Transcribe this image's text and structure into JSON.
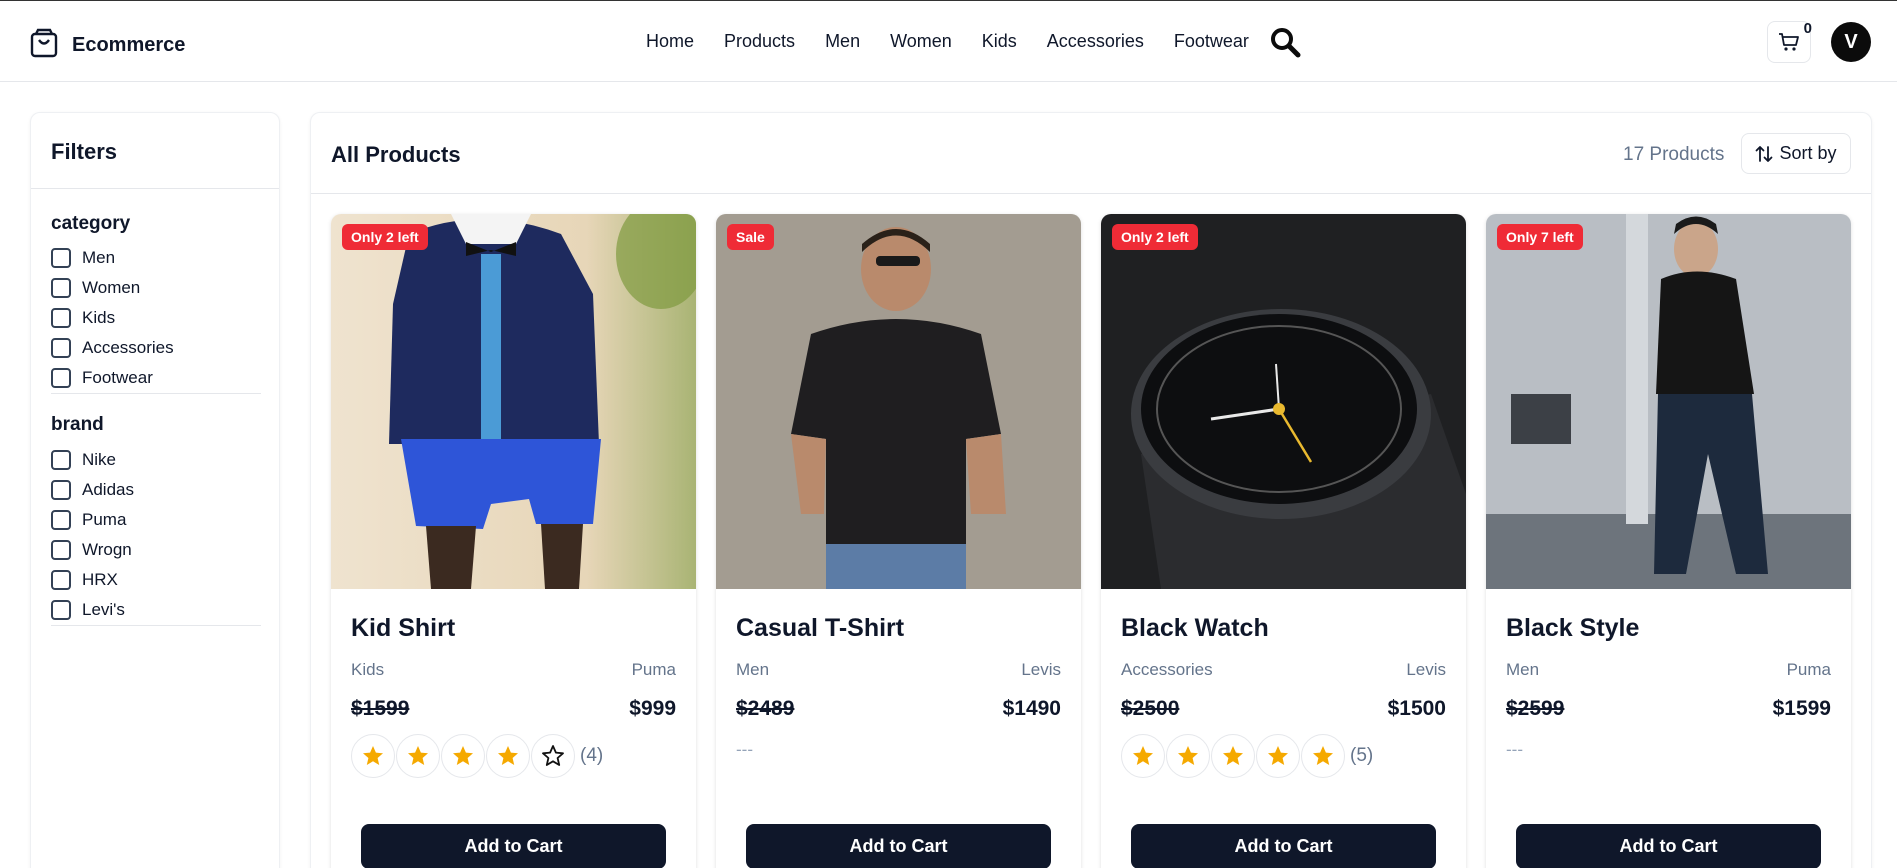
{
  "header": {
    "brand": "Ecommerce",
    "nav": [
      "Home",
      "Products",
      "Men",
      "Women",
      "Kids",
      "Accessories",
      "Footwear"
    ],
    "cart_count": "0",
    "avatar_initial": "V"
  },
  "filters": {
    "title": "Filters",
    "category": {
      "title": "category",
      "options": [
        "Men",
        "Women",
        "Kids",
        "Accessories",
        "Footwear"
      ]
    },
    "brand": {
      "title": "brand",
      "options": [
        "Nike",
        "Adidas",
        "Puma",
        "Wrogn",
        "HRX",
        "Levi's"
      ]
    }
  },
  "products": {
    "title": "All Products",
    "count": "17 Products",
    "sort_label": "Sort by",
    "add_to_cart_label": "Add to Cart",
    "no_rating_text": "---",
    "items": [
      {
        "badge": "Only 2 left",
        "title": "Kid Shirt",
        "category": "Kids",
        "brand": "Puma",
        "old_price": "$1599",
        "price": "$999",
        "rating": 4,
        "rating_count": "(4)",
        "image": "kid-in-navy-cardigan-and-blue-shorts"
      },
      {
        "badge": "Sale",
        "title": "Casual T-Shirt",
        "category": "Men",
        "brand": "Levis",
        "old_price": "$2489",
        "price": "$1490",
        "rating": 0,
        "rating_count": "",
        "image": "man-in-black-tshirt"
      },
      {
        "badge": "Only 2 left",
        "title": "Black Watch",
        "category": "Accessories",
        "brand": "Levis",
        "old_price": "$2500",
        "price": "$1500",
        "rating": 5,
        "rating_count": "(5)",
        "image": "black-analog-watch"
      },
      {
        "badge": "Only 7 left",
        "title": "Black Style",
        "category": "Men",
        "brand": "Puma",
        "old_price": "$2599",
        "price": "$1599",
        "rating": 0,
        "rating_count": "",
        "image": "man-in-black-turtleneck"
      }
    ]
  },
  "colors": {
    "badge": "#ef2b36",
    "button": "#0f172a",
    "star": "#f5a900"
  }
}
